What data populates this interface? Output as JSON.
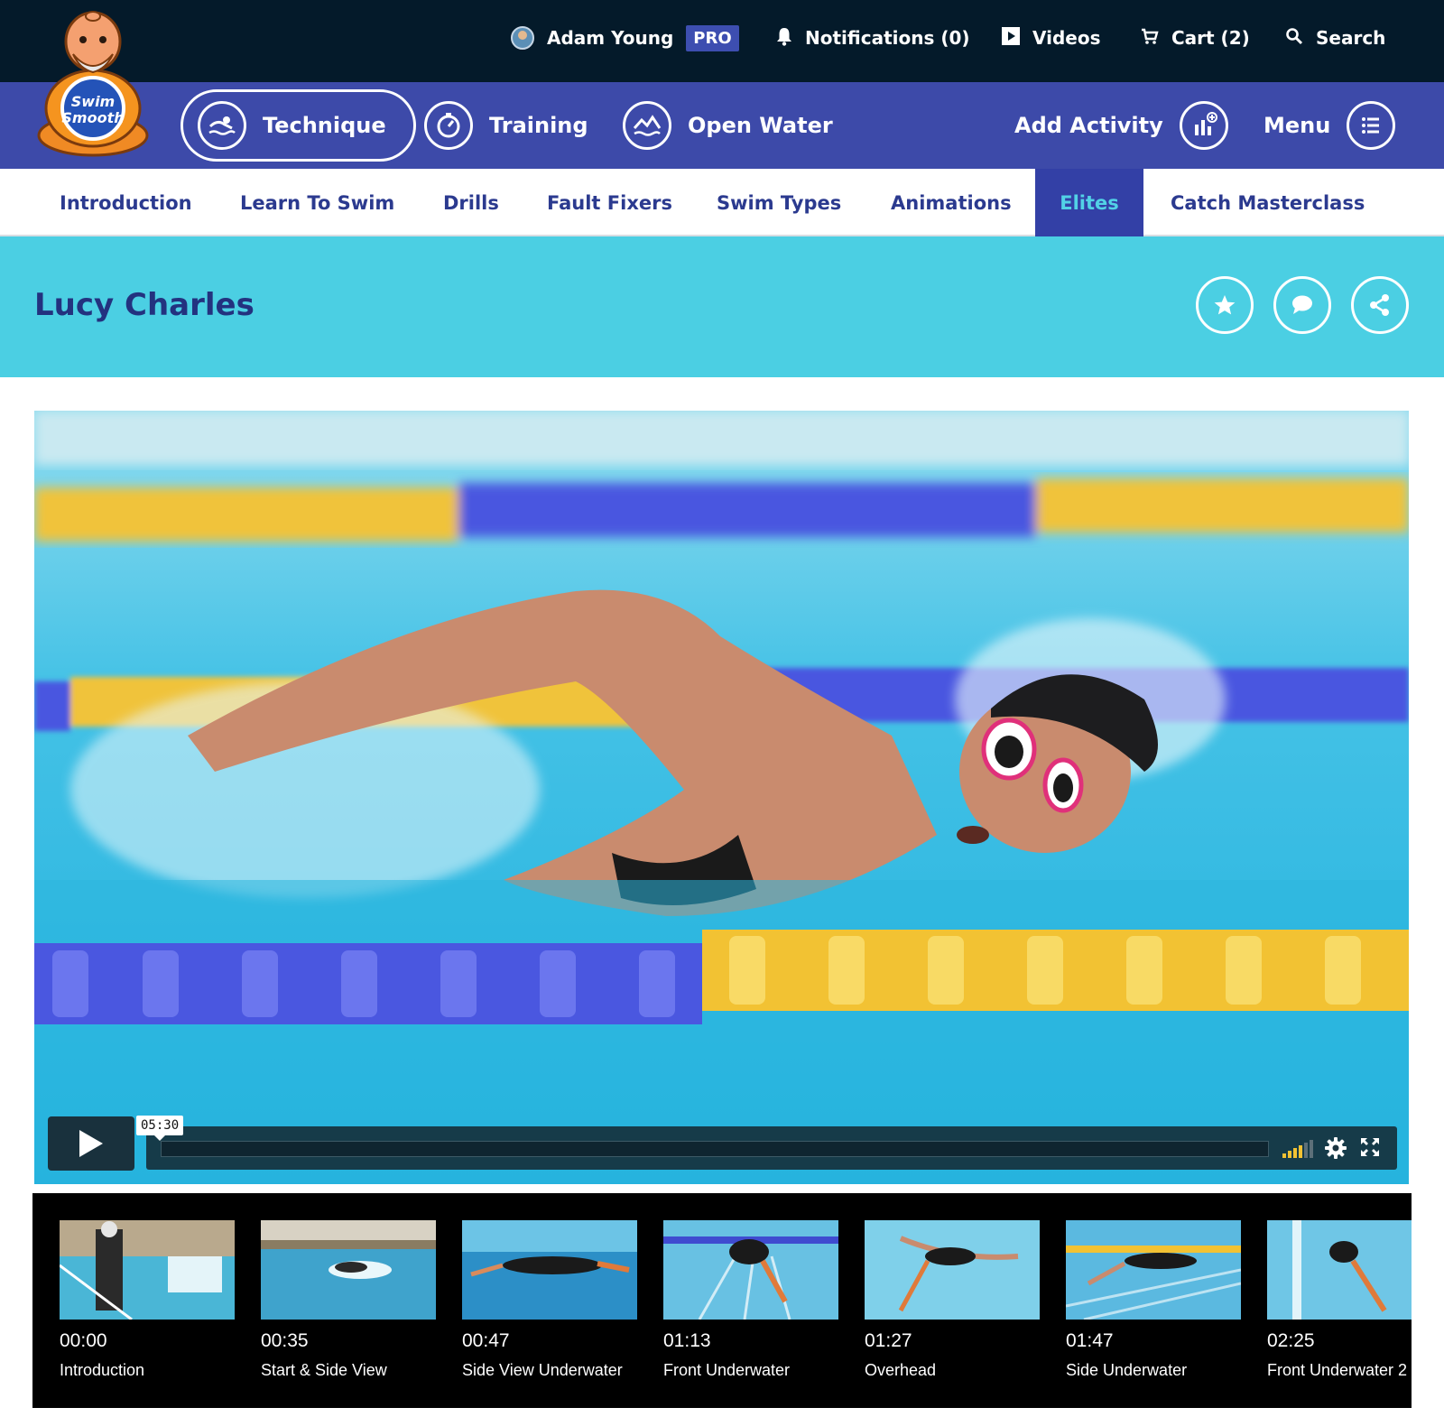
{
  "logo": {
    "text_line1": "Swim",
    "text_line2": "Smooth"
  },
  "topbar": {
    "user_name": "Adam Young",
    "pro_badge": "PRO",
    "notifications": "Notifications (0)",
    "videos": "Videos",
    "cart": "Cart (2)",
    "search": "Search"
  },
  "mainnav": {
    "technique": "Technique",
    "training": "Training",
    "open_water": "Open Water",
    "add_activity": "Add Activity",
    "menu": "Menu"
  },
  "subnav": {
    "items": [
      "Introduction",
      "Learn To Swim",
      "Drills",
      "Fault Fixers",
      "Swim Types",
      "Animations",
      "Elites",
      "Catch Masterclass"
    ],
    "active": "Elites"
  },
  "page": {
    "title": "Lucy Charles"
  },
  "video": {
    "duration": "05:30",
    "progress": 0
  },
  "chapters": [
    {
      "time": "00:00",
      "label": "Introduction"
    },
    {
      "time": "00:35",
      "label": "Start & Side View"
    },
    {
      "time": "00:47",
      "label": "Side View Underwater"
    },
    {
      "time": "01:13",
      "label": "Front Underwater"
    },
    {
      "time": "01:27",
      "label": "Overhead"
    },
    {
      "time": "01:47",
      "label": "Side Underwater"
    },
    {
      "time": "02:25",
      "label": "Front Underwater 2"
    }
  ],
  "colors": {
    "topbar": "#041a2a",
    "nav": "#3d4aa9",
    "accent_cyan": "#4bcfe3",
    "title_text": "#23327f",
    "lane_yellow": "#f2c233",
    "lane_blue": "#4a57e0"
  }
}
